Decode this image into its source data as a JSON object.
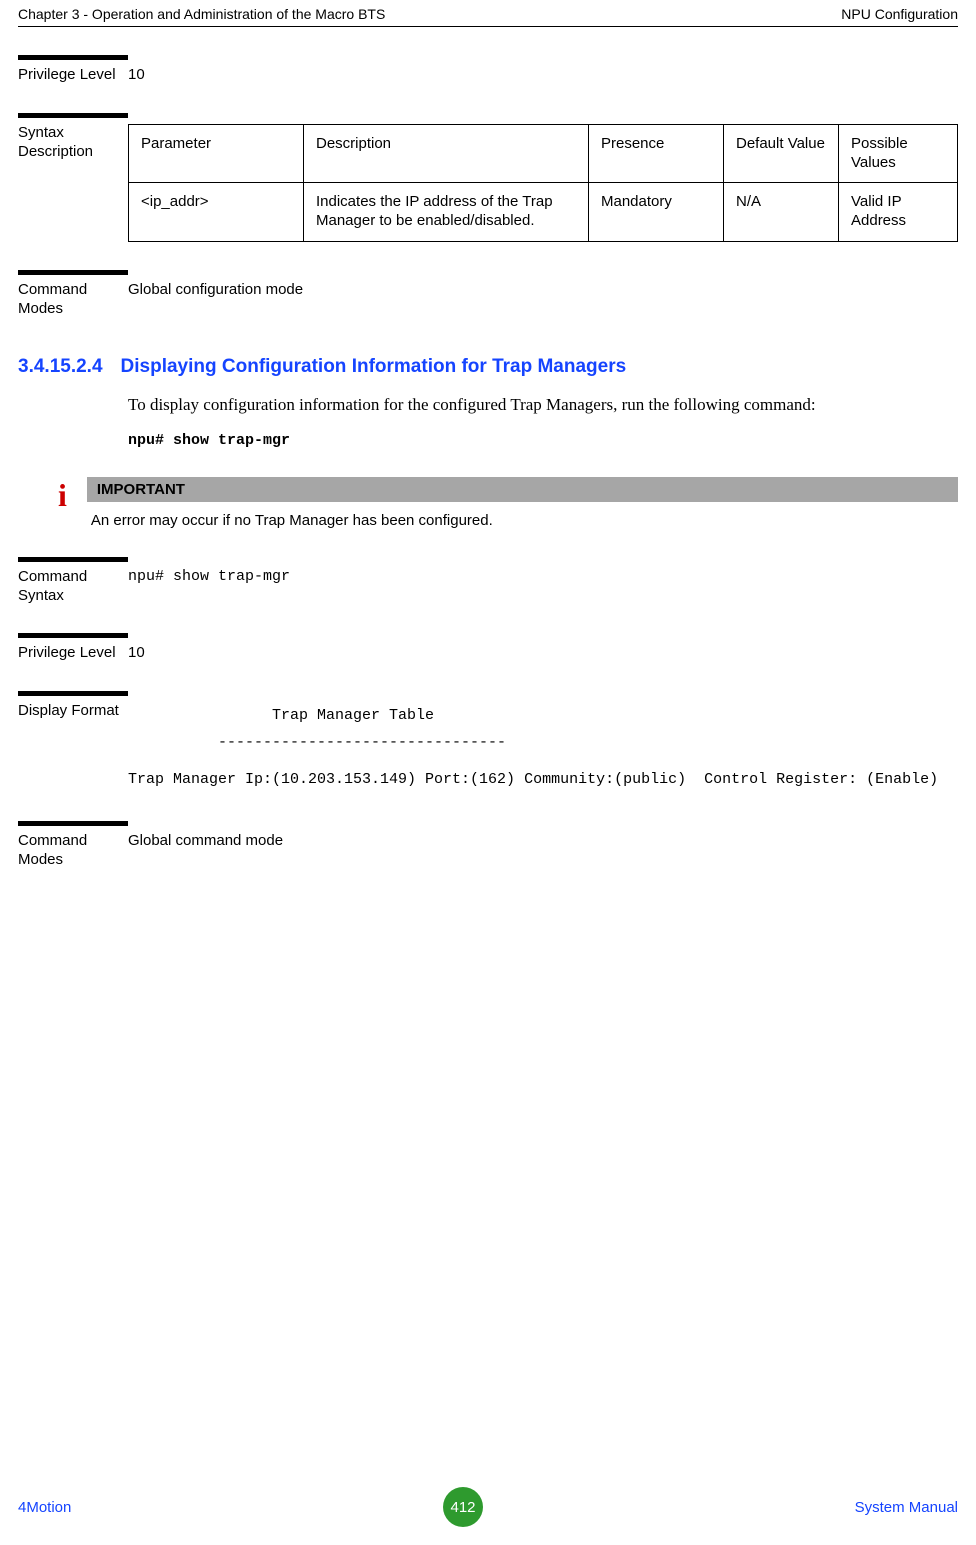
{
  "header": {
    "left": "Chapter 3 - Operation and Administration of the Macro BTS",
    "right": "NPU Configuration"
  },
  "privLevel1": {
    "label": "Privilege Level",
    "value": "10"
  },
  "syntaxDesc": {
    "label": "Syntax Description",
    "headers": {
      "param": "Parameter",
      "desc": "Description",
      "pres": "Presence",
      "def": "Default Value",
      "poss": "Possible Values"
    },
    "row": {
      "param": "<ip_addr>",
      "desc": "Indicates the IP address of the Trap Manager to be enabled/disabled.",
      "pres": "Mandatory",
      "def": "N/A",
      "poss": "Valid IP Address"
    }
  },
  "cmdModes1": {
    "label": "Command Modes",
    "value": "Global configuration mode"
  },
  "heading": {
    "num": "3.4.15.2.4",
    "title": "Displaying Configuration Information for Trap Managers"
  },
  "body1": "To display configuration information for the configured Trap Managers, run the following command:",
  "code1": "npu# show trap-mgr",
  "important": {
    "barLabel": "IMPORTANT",
    "text": "An error may occur if no Trap Manager has been configured."
  },
  "cmdSyntax": {
    "label": "Command Syntax",
    "value": "npu# show trap-mgr"
  },
  "privLevel2": {
    "label": "Privilege Level",
    "value": "10"
  },
  "displayFormat": {
    "label": "Display Format",
    "line1": "                Trap Manager Table",
    "line2": "          --------------------------------",
    "line3": "Trap Manager Ip:(10.203.153.149) Port:(162) Community:(public)  Control Register: (Enable)"
  },
  "cmdModes2": {
    "label": "Command Modes",
    "value": "Global command mode"
  },
  "footer": {
    "left": "4Motion",
    "page": "412",
    "right": "System Manual"
  }
}
